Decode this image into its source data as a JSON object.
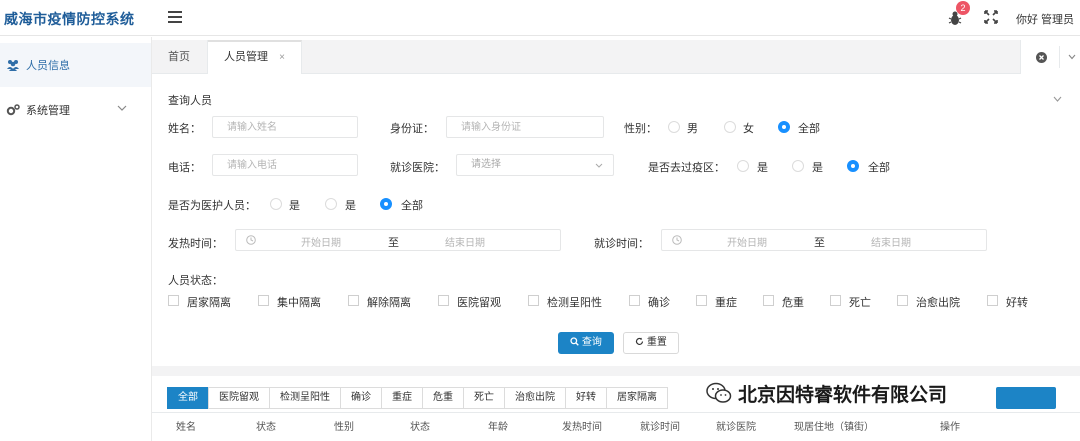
{
  "header": {
    "app_title": "威海市疫情防控系统",
    "notification_count": "2",
    "user_greeting": "你好 管理员"
  },
  "sidebar": {
    "items": [
      {
        "label": "人员信息"
      },
      {
        "label": "系统管理"
      }
    ]
  },
  "tabs": {
    "home": "首页",
    "active": "人员管理",
    "close": "×"
  },
  "query": {
    "title": "查询人员",
    "name_label": "姓名：",
    "name_placeholder": "请输入姓名",
    "idcard_label": "身份证：",
    "idcard_placeholder": "请输入身份证",
    "gender_label": "性别：",
    "gender_options": [
      "男",
      "女",
      "全部"
    ],
    "phone_label": "电话：",
    "phone_placeholder": "请输入电话",
    "hospital_label": "就诊医院：",
    "hospital_placeholder": "请选择",
    "epidemic_label": "是否去过疫区：",
    "epidemic_options": [
      "是",
      "是",
      "全部"
    ],
    "medical_label": "是否为医护人员：",
    "medical_options": [
      "是",
      "是",
      "全部"
    ],
    "fever_label": "发热时间：",
    "visit_label": "就诊时间：",
    "start_date": "开始日期",
    "to": "至",
    "end_date": "结束日期",
    "status_label": "人员状态：",
    "statuses": [
      "居家隔离",
      "集中隔离",
      "解除隔离",
      "医院留观",
      "检测呈阳性",
      "确诊",
      "重症",
      "危重",
      "死亡",
      "治愈出院",
      "好转"
    ],
    "query_button": "查询",
    "reset_button": "重置"
  },
  "list": {
    "filter_tabs": [
      "全部",
      "医院留观",
      "检测呈阳性",
      "确诊",
      "重症",
      "危重",
      "死亡",
      "治愈出院",
      "好转",
      "居家隔离"
    ],
    "columns": [
      "姓名",
      "状态",
      "性别",
      "状态",
      "年龄",
      "发热时间",
      "就诊时间",
      "就诊医院",
      "现居住地（镇街）",
      "操作"
    ]
  },
  "watermark": {
    "text": "北京因特睿软件有限公司"
  },
  "colors": {
    "primary": "#1c84c6",
    "title": "#1f5d99",
    "badge": "#ed5565"
  }
}
